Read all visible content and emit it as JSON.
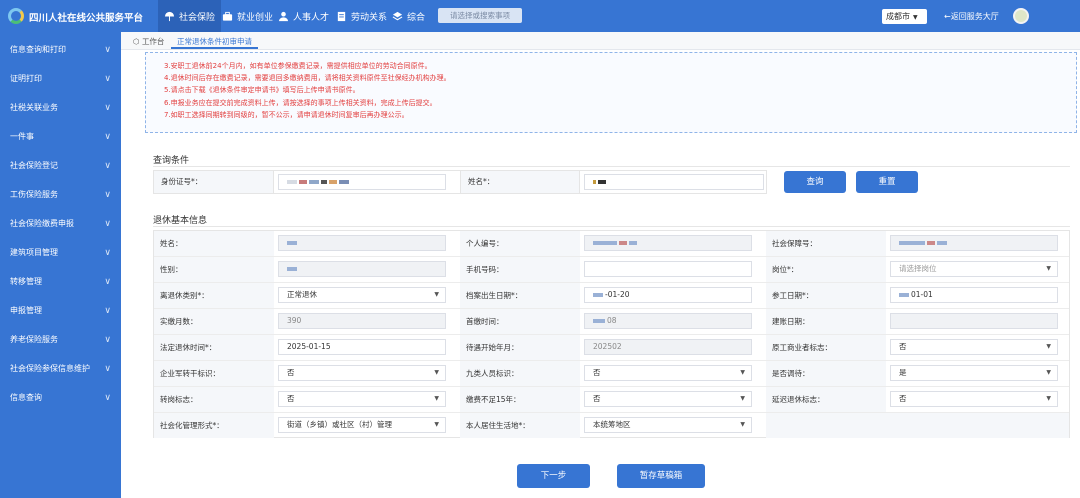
{
  "header": {
    "site_title": "四川人社在线公共服务平台",
    "nav": [
      {
        "label": "社会保险",
        "icon": "umbrella-hands-icon",
        "active": true
      },
      {
        "label": "就业创业",
        "icon": "briefcase-icon",
        "active": false
      },
      {
        "label": "人事人才",
        "icon": "person-icon",
        "active": false
      },
      {
        "label": "劳动关系",
        "icon": "document-icon",
        "active": false
      },
      {
        "label": "综合",
        "icon": "layers-icon",
        "active": false
      }
    ],
    "search_placeholder": "请选择或搜索事项",
    "city": "成都市",
    "back_label": "←返回服务大厅"
  },
  "sidebar": {
    "items": [
      {
        "label": "信息查询和打印"
      },
      {
        "label": "证明打印"
      },
      {
        "label": "社税关联业务"
      },
      {
        "label": "一件事"
      },
      {
        "label": "社会保险登记"
      },
      {
        "label": "工伤保险服务"
      },
      {
        "label": "社会保险缴费申报"
      },
      {
        "label": "建筑项目管理"
      },
      {
        "label": "转移管理"
      },
      {
        "label": "申报管理"
      },
      {
        "label": "养老保险服务"
      },
      {
        "label": "社会保险参保信息维护"
      },
      {
        "label": "信息查询"
      }
    ]
  },
  "tabs": {
    "home": "工作台",
    "current": "正常退休条件初审申请"
  },
  "notice": {
    "lines": [
      "3.安职工退休前24个月内，如有单位参保缴费记录，需提供相应单位的劳动合同原件。",
      "4.退休时间后存在缴费记录，需要退回多缴纳费用，请将相关资料原件至社保经办机构办理。",
      "5.请点击下载《退休条件审定申请书》填写后上传申请书原件。",
      "6.申报业务应在提交前完成资料上传，请按选择的事项上传相关资料，完成上传后提交。",
      "7.如职工选择同期转到同级的，暂不公示，请申请退休时间复审后再办理公示。"
    ]
  },
  "query": {
    "title": "查询条件",
    "id_label": "身份证号*：",
    "name_label": "姓名*：",
    "query_btn": "查询",
    "reset_btn": "重置"
  },
  "info": {
    "title": "退休基本信息",
    "rows": [
      [
        {
          "label": "姓名：",
          "value": "",
          "state": "dis",
          "masked": true
        },
        {
          "label": "个人编号：",
          "value": "",
          "state": "dis",
          "masked": true
        },
        {
          "label": "社会保障号：",
          "value": "",
          "state": "dis",
          "masked": true
        }
      ],
      [
        {
          "label": "性别：",
          "value": "",
          "state": "dis",
          "masked": true
        },
        {
          "label": "手机号码：",
          "value": "",
          "state": "input"
        },
        {
          "label": "岗位*：",
          "value": "请选择岗位",
          "state": "select-ph"
        }
      ],
      [
        {
          "label": "离退休类别*：",
          "value": "正常退休",
          "state": "select"
        },
        {
          "label": "档案出生日期*：",
          "value": "-01-20",
          "state": "input",
          "masked": true
        },
        {
          "label": "参工日期*：",
          "value": "01-01",
          "state": "input",
          "masked": true
        }
      ],
      [
        {
          "label": "实缴月数：",
          "value": "390",
          "state": "dis"
        },
        {
          "label": "首缴时间：",
          "value": "08",
          "state": "dis",
          "masked": true
        },
        {
          "label": "建账日期：",
          "value": "",
          "state": "dis"
        }
      ],
      [
        {
          "label": "法定退休时间*：",
          "value": "2025-01-15",
          "state": "input"
        },
        {
          "label": "待遇开始年月：",
          "value": "202502",
          "state": "dis"
        },
        {
          "label": "原工商业者标志：",
          "value": "否",
          "state": "select"
        }
      ],
      [
        {
          "label": "企业军转干标识：",
          "value": "否",
          "state": "select"
        },
        {
          "label": "九类人员标识：",
          "value": "否",
          "state": "select"
        },
        {
          "label": "是否调待：",
          "value": "是",
          "state": "select"
        }
      ],
      [
        {
          "label": "转岗标志：",
          "value": "否",
          "state": "select"
        },
        {
          "label": "缴费不足15年：",
          "value": "否",
          "state": "select"
        },
        {
          "label": "延迟退休标志：",
          "value": "否",
          "state": "select"
        }
      ],
      [
        {
          "label": "社会化管理形式*：",
          "value": "街道（乡镇）或社区（村）管理",
          "state": "select"
        },
        {
          "label": "本人居住生活地*：",
          "value": "本统筹地区",
          "state": "select"
        },
        null
      ]
    ]
  },
  "footer": {
    "next_btn": "下一步",
    "draft_btn": "暂存草稿箱"
  },
  "colors": {
    "primary": "#3775d3",
    "notice_text": "#e23d3d"
  }
}
